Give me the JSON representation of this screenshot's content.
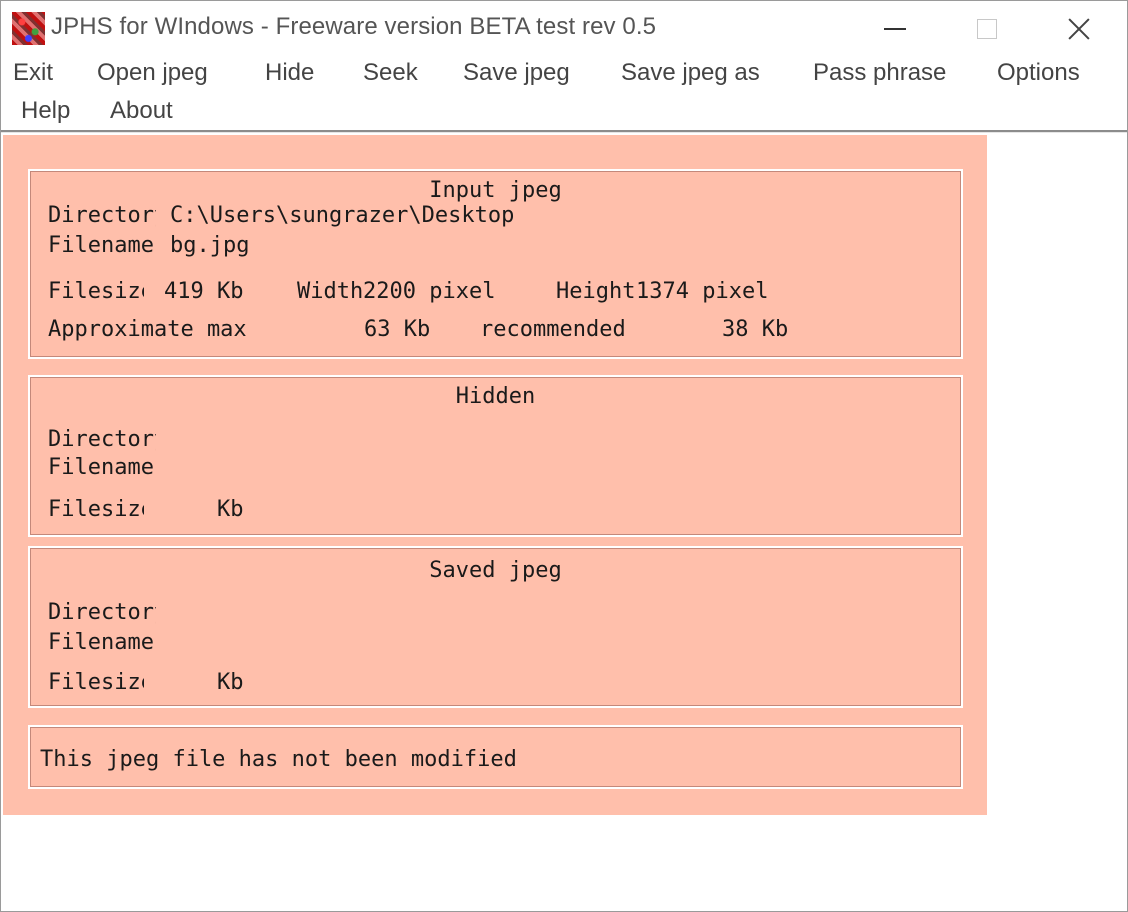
{
  "window": {
    "title": "JPHS for WIndows - Freeware version BETA test rev 0.5",
    "client_color": "#ffbfab"
  },
  "menu": {
    "items": [
      "Exit",
      "Open jpeg",
      "Hide",
      "Seek",
      "Save jpeg",
      "Save jpeg as",
      "Pass phrase",
      "Options",
      "Help",
      "About"
    ]
  },
  "input_jpeg": {
    "heading": "Input jpeg",
    "directory_label": "Directory",
    "directory_value": "C:\\Users\\sungrazer\\Desktop",
    "filename_label": "Filename",
    "filename_value": "bg.jpg",
    "filesize_label": "Filesize",
    "filesize_value": "419 Kb",
    "width_label": "Width",
    "width_value": "2200 pixel",
    "height_label": "Height",
    "height_value": "1374 pixel",
    "approx_label": "Approximate max",
    "approx_value": "63 Kb",
    "recommended_label": "recommended",
    "recommended_value": "38 Kb"
  },
  "hidden": {
    "heading": "Hidden",
    "directory_label": "Directory",
    "filename_label": "Filename",
    "filesize_label": "Filesize",
    "filesize_unit": "Kb"
  },
  "saved_jpeg": {
    "heading": "Saved jpeg",
    "directory_label": "Directory",
    "filename_label": "Filename",
    "filesize_label": "Filesize",
    "filesize_unit": "Kb"
  },
  "status": {
    "message": "This jpeg file has not been modified"
  }
}
